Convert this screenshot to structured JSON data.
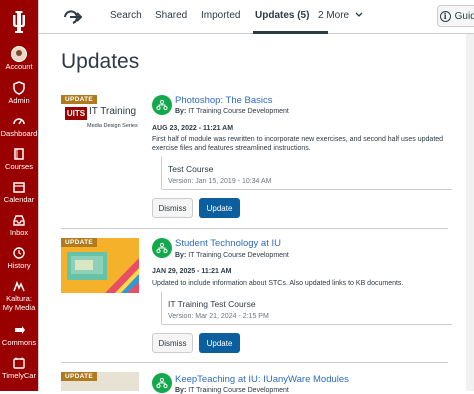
{
  "nav": {
    "items": [
      {
        "label": "Account",
        "icon": "avatar-icon"
      },
      {
        "label": "Admin",
        "icon": "shield-icon"
      },
      {
        "label": "Dashboard",
        "icon": "dashboard-icon"
      },
      {
        "label": "Courses",
        "icon": "book-icon"
      },
      {
        "label": "Calendar",
        "icon": "calendar-icon"
      },
      {
        "label": "Inbox",
        "icon": "inbox-icon"
      },
      {
        "label": "History",
        "icon": "clock-icon"
      },
      {
        "label": "Kaltura:\nMy Media",
        "icon": "kaltura-icon"
      },
      {
        "label": "Commons",
        "icon": "commons-icon"
      },
      {
        "label": "TimelyCar",
        "icon": "timely-icon"
      }
    ]
  },
  "tabs": {
    "search": "Search",
    "shared": "Shared",
    "imported": "Imported",
    "updates": "Updates (5)",
    "more": "2 More",
    "guides": "Guides"
  },
  "page": {
    "title": "Updates"
  },
  "updates": [
    {
      "badge": "UPDATE",
      "title": "Photoshop: The Basics",
      "by_label": "By:",
      "by": "IT Training Course Development",
      "date": "AUG 23, 2022 - 11:21 AM",
      "desc": "First half of module was rewritten to incorporate new exercises, and second half uses updated exercise files and features streamlined instructions.",
      "course": "Test Course",
      "version": "Version: Jan 15, 2019 - 10:34 AM",
      "dismiss": "Dismiss",
      "update": "Update",
      "thumb_text_1": "UITS",
      "thumb_text_2": "IT Training",
      "thumb_text_3": "Media Design Series"
    },
    {
      "badge": "UPDATE",
      "title": "Student Technology at IU",
      "by_label": "By:",
      "by": "IT Training Course Development",
      "date": "JAN 29, 2025 - 11:21 AM",
      "desc": "Updated to include information about STCs. Also updated links to KB documents.",
      "course": "IT Training Test Course",
      "version": "Version: Mar 21, 2024 - 2:15 PM",
      "dismiss": "Dismiss",
      "update": "Update"
    },
    {
      "badge": "UPDATE",
      "title": "KeepTeaching at IU: IUanyWare Modules",
      "by_label": "By:",
      "by": "IT Training Course Development"
    }
  ],
  "colors": {
    "nav_bg": "#990000",
    "link": "#2d6bbf",
    "primary_button": "#0b5f9e",
    "badge": "#b07a1e",
    "course_icon": "#11a94b"
  }
}
